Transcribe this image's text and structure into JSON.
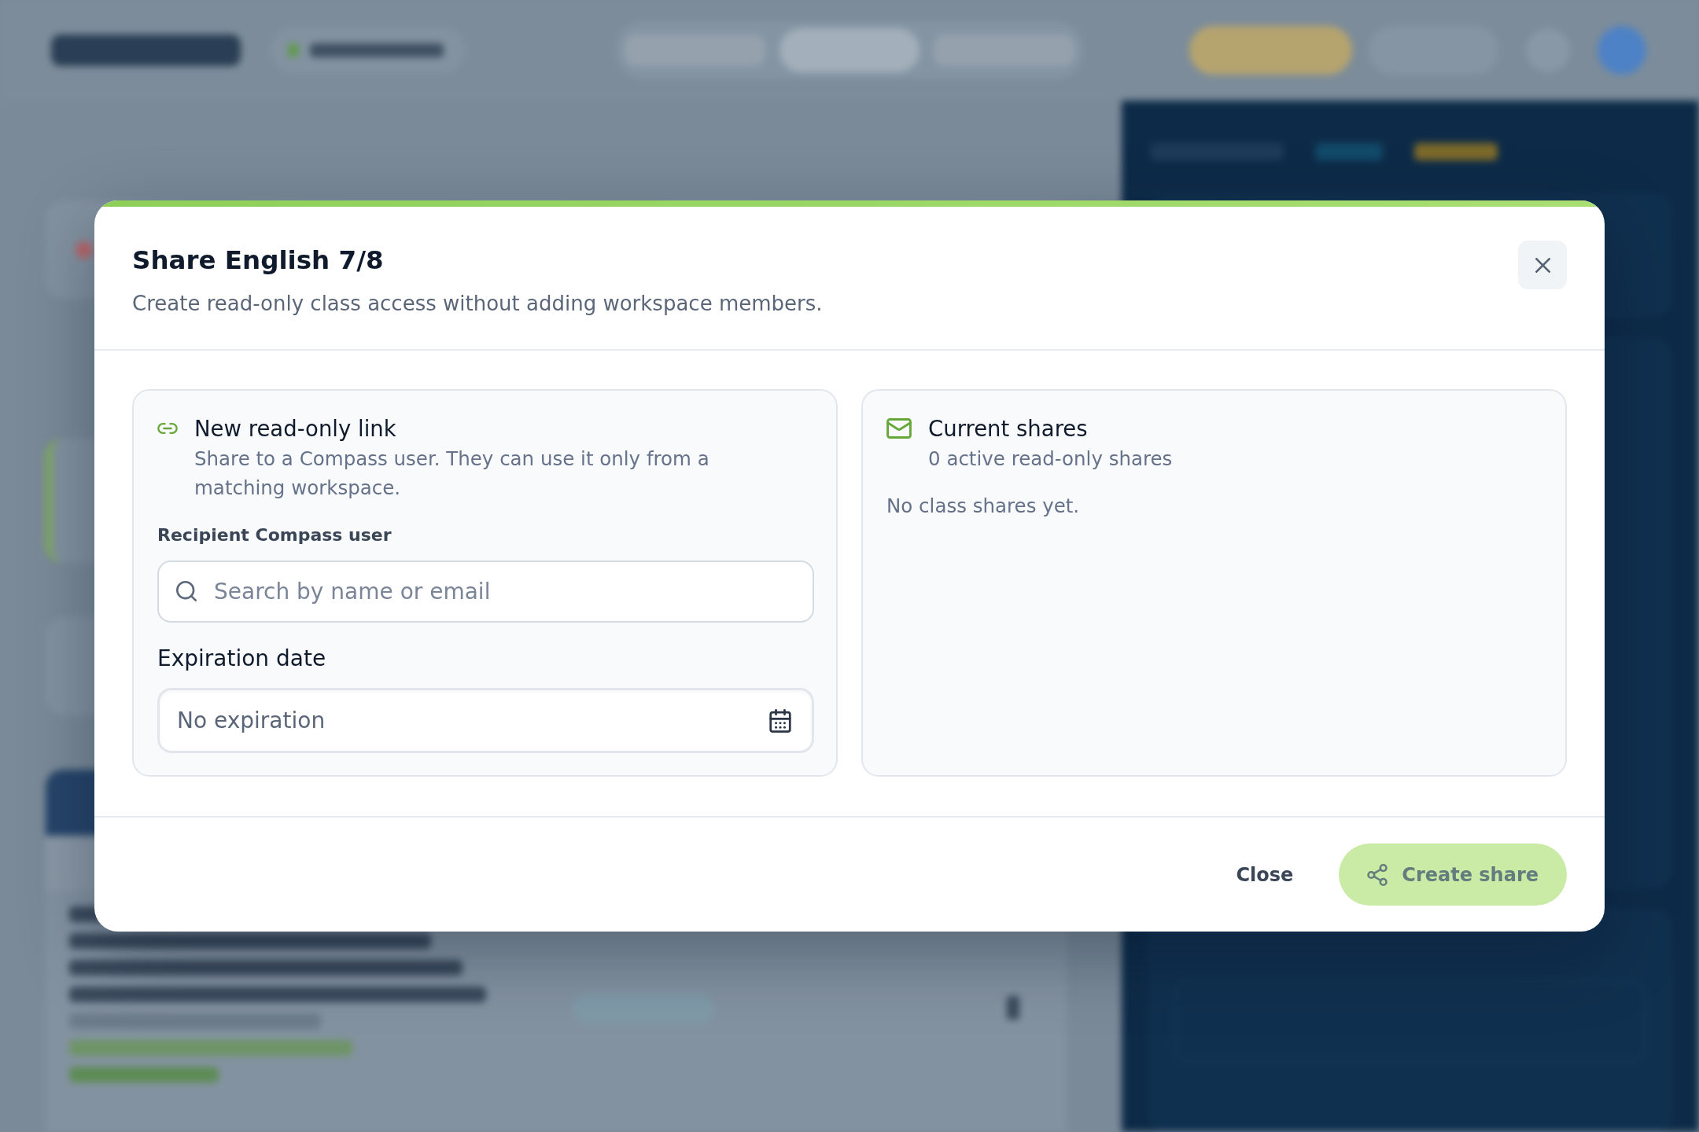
{
  "dialog": {
    "title": "Share English 7/8",
    "subtitle": "Create read-only class access without adding workspace members.",
    "panels": [
      {
        "kind": "link",
        "title": "New read-only link",
        "description": "Share to a Compass user. They can use it only from a matching workspace.",
        "fields": [
          {
            "kind": "search",
            "label": "Recipient Compass user",
            "placeholder": "Search by name or email"
          },
          {
            "kind": "date",
            "label": "Expiration date",
            "value": "No expiration"
          }
        ]
      },
      {
        "kind": "mail",
        "title": "Current shares",
        "description": "0 active read-only shares",
        "empty_message": "No class shares yet."
      }
    ],
    "footer_buttons": [
      {
        "kind": "text",
        "label": "Close",
        "disabled": false
      },
      {
        "kind": "primary",
        "label": "Create share",
        "disabled": true
      }
    ]
  }
}
